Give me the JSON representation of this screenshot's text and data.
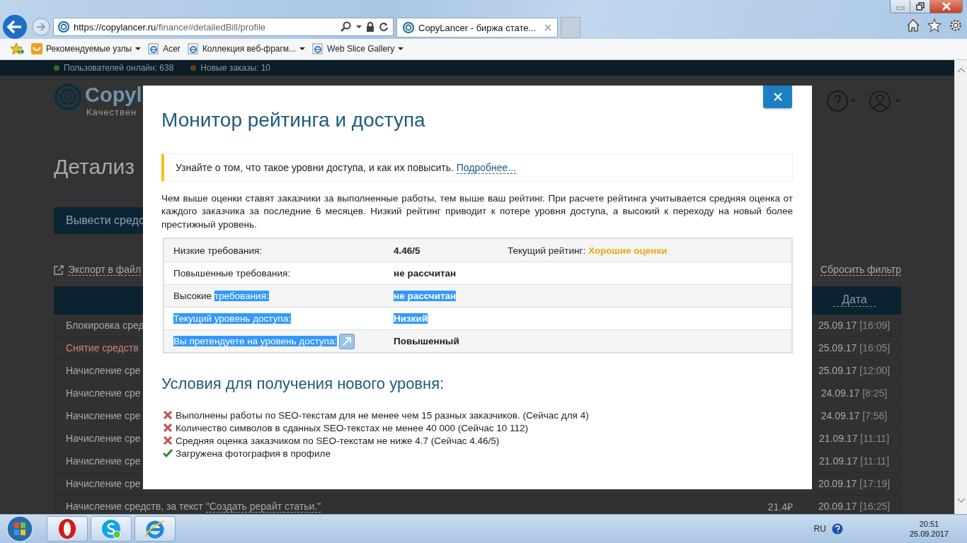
{
  "browser": {
    "address": {
      "host": "https://copylancer.ru",
      "path": "/finance#detailedBill/profile"
    },
    "tab": {
      "title": "CopyLancer - биржа стате...",
      "selected": true
    },
    "favorites": [
      {
        "label": "Рекомендуемые узлы",
        "kind": "suggested",
        "dropdown": true
      },
      {
        "label": "Acer",
        "kind": "ie",
        "dropdown": false
      },
      {
        "label": "Коллекция веб-фрагм...",
        "kind": "ie",
        "dropdown": true
      },
      {
        "label": "Web Slice Gallery",
        "kind": "ie",
        "dropdown": true
      }
    ]
  },
  "site": {
    "stats": [
      {
        "label": "Пользователей онлайн: 638",
        "color": "#2e6b2e"
      },
      {
        "label": "Новые заказы: 10",
        "color": "#6b3a12"
      }
    ],
    "logo": {
      "name": "Copyl",
      "tagline": "Качествен"
    },
    "page_title": "Детализ",
    "withdraw_button": "Вывести средс",
    "export_link": "Экспорт в файл",
    "reset_filter": "Сбросить фильтр",
    "table": {
      "date_header": "Дата",
      "rows": [
        {
          "description": "Блокировка сред",
          "kind": "normal",
          "date": "25.09.17",
          "time": "[16:09]"
        },
        {
          "description": "Снятие средств",
          "kind": "withdrawal",
          "date": "25.09.17",
          "time": "[16:05]"
        },
        {
          "description": "Начисление сре",
          "kind": "normal",
          "date": "25.09.17",
          "time": "[12:00]"
        },
        {
          "description": "Начисление сре",
          "kind": "normal",
          "date": "24.09.17",
          "time": "[8:25]"
        },
        {
          "description": "Начисление сре",
          "kind": "normal",
          "date": "24.09.17",
          "time": "[7:56]"
        },
        {
          "description": "Начисление сре",
          "kind": "normal",
          "date": "21.09.17",
          "time": "[11:11]"
        },
        {
          "description": "Начисление сре",
          "kind": "normal",
          "date": "21.09.17",
          "time": "[11:11]"
        },
        {
          "description": "Начисление сре",
          "kind": "normal",
          "date": "20.09.17",
          "time": "[17:19]"
        },
        {
          "description": "Начисление средств, за текст ",
          "link": "\"Создать рерайт статьи.\"",
          "amount": "21.4₽",
          "kind": "normal",
          "date": "20.09.17",
          "time": "[16:25]"
        }
      ]
    }
  },
  "modal": {
    "title": "Монитор рейтинга и доступа",
    "notice": {
      "text": "Узнайте о том, что такое уровни доступа, и как их повысить. ",
      "link": "Подробнее..."
    },
    "paragraph": "Чем выше оценки ставят заказчики за выполненные работы, тем выше ваш рейтинг. При расчете рейтинга учитывается средняя оценка от каждого заказчика за последние 6 месяцев. Низкий рейтинг приводит к потере уровня доступа, а высокий к переходу на новый более престижный уровень.",
    "rows": [
      {
        "label": [
          {
            "text": "Низкие требования:",
            "highlighted": false
          }
        ],
        "link_icon": false,
        "value": {
          "text": "4.46/5",
          "highlighted": false
        },
        "extra": {
          "label": "Текущий рейтинг: ",
          "value": "Хорошие оценки"
        }
      },
      {
        "label": [
          {
            "text": "Повышенные требования:",
            "highlighted": false
          }
        ],
        "link_icon": false,
        "value": {
          "text": "не рассчитан",
          "highlighted": false
        }
      },
      {
        "label": [
          {
            "text": "Высокие ",
            "highlighted": false
          },
          {
            "text": "требования:",
            "highlighted": true
          }
        ],
        "link_icon": false,
        "value": {
          "text": "не рассчитан",
          "highlighted": true
        }
      },
      {
        "label": [
          {
            "text": "Текущий уровень доступа:",
            "highlighted": true
          }
        ],
        "link_icon": false,
        "value": {
          "text": "Низкий",
          "highlighted": true
        }
      },
      {
        "label": [
          {
            "text": "Вы претендуете на уровень доступа:",
            "highlighted": true
          }
        ],
        "link_icon": true,
        "value": {
          "text": "Повышенный",
          "highlighted": false
        }
      }
    ],
    "subtitle": "Условия для получения нового уровня:",
    "conditions": [
      {
        "text": "Выполнены работы по SEO-текстам для не менее чем 15 разных заказчиков. (Сейчас для 4)",
        "met": false
      },
      {
        "text": "Количество символов в сданных SEO-текстах не менее 40 000 (Сейчас 10 112)",
        "met": false
      },
      {
        "text": "Средняя оценка заказчиком по SEO-текстам не ниже 4.7 (Сейчас 4.46/5)",
        "met": false
      },
      {
        "text": "Загружена фотография в профиле",
        "met": true
      }
    ]
  },
  "taskbar": {
    "apps": [
      {
        "kind": "opera"
      },
      {
        "kind": "skype"
      },
      {
        "kind": "ie"
      }
    ],
    "language": "RU",
    "time": "20:51",
    "date": "25.09.2017"
  }
}
